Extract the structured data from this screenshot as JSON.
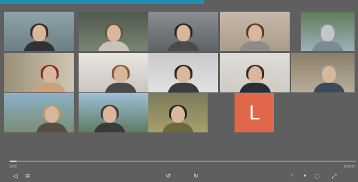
{
  "player": {
    "accent_color": "#1e8fb0",
    "background_color": "#5f5f5f",
    "progress": 0.02,
    "current_time": "0:03",
    "total_time": "1:09:41"
  },
  "avatar": {
    "initial": "L",
    "color": "#e0674a"
  },
  "controls": {
    "play_icon": "◁",
    "captions_icon": "≡",
    "rewind_icon": "↺",
    "forward_icon": "↻",
    "volume_icon": "◜",
    "settings_icon": "•",
    "pip_icon": "◌",
    "fullscreen_icon": "⤢"
  }
}
